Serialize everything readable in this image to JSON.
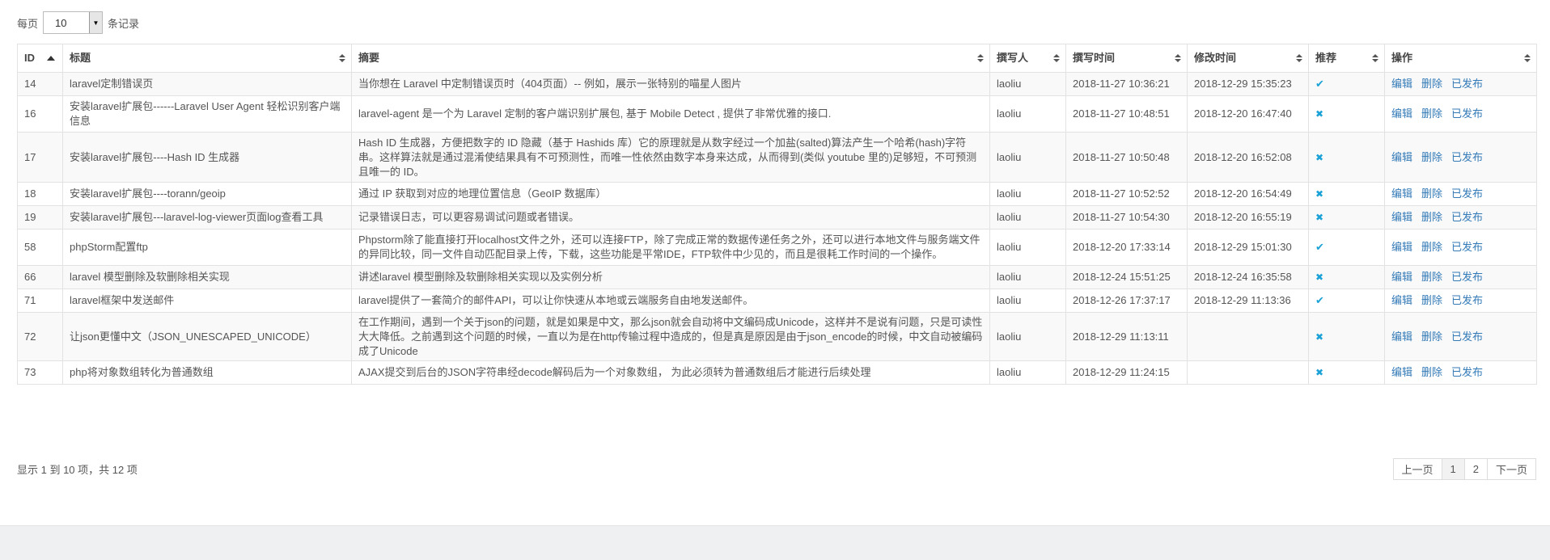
{
  "length_menu": {
    "prefix": "每页",
    "value": "10",
    "suffix": "条记录"
  },
  "columns": [
    {
      "label": "ID"
    },
    {
      "label": "标题"
    },
    {
      "label": "摘要"
    },
    {
      "label": "撰写人"
    },
    {
      "label": "撰写时间"
    },
    {
      "label": "修改时间"
    },
    {
      "label": "推荐"
    },
    {
      "label": "操作"
    }
  ],
  "rows": [
    {
      "id": "14",
      "title": "laravel定制错误页",
      "summary": "当你想在 Laravel 中定制错误页时（404页面）-- 例如，展示一张特别的喵星人图片",
      "author": "laoliu",
      "created": "2018-11-27 10:36:21",
      "modified": "2018-12-29 15:35:23",
      "recommend": "✔",
      "edit": "编辑",
      "delete": "删除",
      "status": "已发布"
    },
    {
      "id": "16",
      "title": "安装laravel扩展包------Laravel User Agent 轻松识别客户端信息",
      "summary": "laravel-agent 是一个为 Laravel 定制的客户端识别扩展包, 基于 Mobile Detect , 提供了非常优雅的接口.",
      "author": "laoliu",
      "created": "2018-11-27 10:48:51",
      "modified": "2018-12-20 16:47:40",
      "recommend": "✖",
      "edit": "编辑",
      "delete": "删除",
      "status": "已发布"
    },
    {
      "id": "17",
      "title": "安装laravel扩展包----Hash ID 生成器",
      "summary": "Hash ID 生成器，方便把数字的 ID 隐藏（基于 Hashids 库）它的原理就是从数字经过一个加盐(salted)算法产生一个哈希(hash)字符串。这样算法就是通过混淆使结果具有不可预测性，而唯一性依然由数字本身来达成，从而得到(类似 youtube 里的)足够短，不可预测且唯一的 ID。",
      "author": "laoliu",
      "created": "2018-11-27 10:50:48",
      "modified": "2018-12-20 16:52:08",
      "recommend": "✖",
      "edit": "编辑",
      "delete": "删除",
      "status": "已发布"
    },
    {
      "id": "18",
      "title": "安装laravel扩展包----torann/geoip",
      "summary": "通过 IP 获取到对应的地理位置信息（GeoIP 数据库）",
      "author": "laoliu",
      "created": "2018-11-27 10:52:52",
      "modified": "2018-12-20 16:54:49",
      "recommend": "✖",
      "edit": "编辑",
      "delete": "删除",
      "status": "已发布"
    },
    {
      "id": "19",
      "title": "安装laravel扩展包---laravel-log-viewer页面log查看工具",
      "summary": "记录错误日志，可以更容易调试问题或者错误。",
      "author": "laoliu",
      "created": "2018-11-27 10:54:30",
      "modified": "2018-12-20 16:55:19",
      "recommend": "✖",
      "edit": "编辑",
      "delete": "删除",
      "status": "已发布"
    },
    {
      "id": "58",
      "title": "phpStorm配置ftp",
      "summary": "Phpstorm除了能直接打开localhost文件之外，还可以连接FTP，除了完成正常的数据传递任务之外，还可以进行本地文件与服务端文件的异同比较，同一文件自动匹配目录上传，下载，这些功能是平常IDE，FTP软件中少见的，而且是很耗工作时间的一个操作。",
      "author": "laoliu",
      "created": "2018-12-20 17:33:14",
      "modified": "2018-12-29 15:01:30",
      "recommend": "✔",
      "edit": "编辑",
      "delete": "删除",
      "status": "已发布"
    },
    {
      "id": "66",
      "title": "laravel 模型删除及软删除相关实现",
      "summary": "讲述laravel 模型删除及软删除相关实现以及实例分析",
      "author": "laoliu",
      "created": "2018-12-24 15:51:25",
      "modified": "2018-12-24 16:35:58",
      "recommend": "✖",
      "edit": "编辑",
      "delete": "删除",
      "status": "已发布"
    },
    {
      "id": "71",
      "title": "laravel框架中发送邮件",
      "summary": "laravel提供了一套简介的邮件API，可以让你快速从本地或云端服务自由地发送邮件。",
      "author": "laoliu",
      "created": "2018-12-26 17:37:17",
      "modified": "2018-12-29 11:13:36",
      "recommend": "✔",
      "edit": "编辑",
      "delete": "删除",
      "status": "已发布"
    },
    {
      "id": "72",
      "title": "让json更懂中文（JSON_UNESCAPED_UNICODE）",
      "summary": "在工作期间，遇到一个关于json的问题，就是如果是中文，那么json就会自动将中文编码成Unicode，这样并不是说有问题，只是可读性大大降低。之前遇到这个问题的时候，一直以为是在http传输过程中造成的，但是真是原因是由于json_encode的时候，中文自动被编码成了Unicode",
      "author": "laoliu",
      "created": "2018-12-29 11:13:11",
      "modified": "",
      "recommend": "✖",
      "edit": "编辑",
      "delete": "删除",
      "status": "已发布"
    },
    {
      "id": "73",
      "title": "php将对象数组转化为普通数组",
      "summary": "AJAX提交到后台的JSON字符串经decode解码后为一个对象数组， 为此必须转为普通数组后才能进行后续处理",
      "author": "laoliu",
      "created": "2018-12-29 11:24:15",
      "modified": "",
      "recommend": "✖",
      "edit": "编辑",
      "delete": "删除",
      "status": "已发布"
    }
  ],
  "info": "显示 1 到 10 项，共 12 项",
  "pagination": {
    "prev": "上一页",
    "pages": [
      "1",
      "2"
    ],
    "active": "1",
    "next": "下一页"
  }
}
